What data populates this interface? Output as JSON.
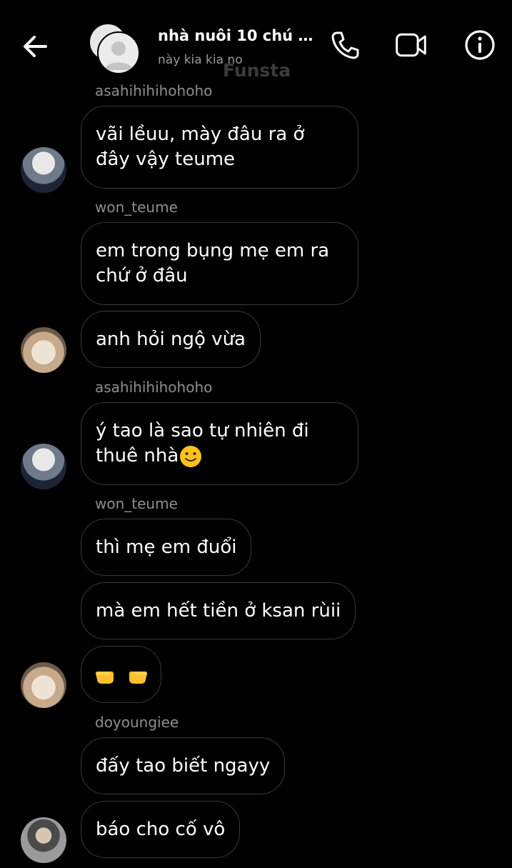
{
  "header": {
    "title": "nhà nuôi 10 chú ...",
    "subtitle": "này kia kia no",
    "watermark": "Funsta",
    "icons": {
      "back": "back-arrow-icon",
      "call": "phone-icon",
      "video": "video-camera-icon",
      "info": "info-icon"
    }
  },
  "messages": [
    {
      "sender": "asahihihihohoho",
      "text": "vãi lềuu, mày đâu ra ở đây vậy teume"
    },
    {
      "sender": "won_teume",
      "text": "em trong bụng mẹ em ra chứ ở đâu"
    },
    {
      "text": "anh hỏi ngộ vừa"
    },
    {
      "sender": "asahihihihohoho",
      "text": "ý tao là sao tự nhiên đi thuê nhà",
      "emoji": "slightly-smiling-face"
    },
    {
      "sender": "won_teume",
      "text": "thì mẹ em đuổi"
    },
    {
      "text": "mà em hết tiền ở ksan rùii"
    },
    {
      "emoji": "pointing-hands"
    },
    {
      "sender": "doyoungiee",
      "text": "đấy tao biết ngayy"
    },
    {
      "text": "báo cho cố vô"
    }
  ],
  "colors": {
    "background": "#000000",
    "bubble_border": "#3a3a3a",
    "sender_text": "#8e8e8e",
    "subtitle": "#9a9a9a"
  }
}
